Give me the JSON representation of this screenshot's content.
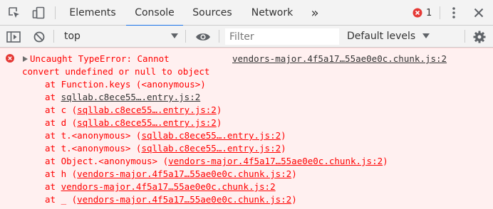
{
  "tabs": [
    {
      "label": "Elements",
      "active": false
    },
    {
      "label": "Console",
      "active": true
    },
    {
      "label": "Sources",
      "active": false
    },
    {
      "label": "Network",
      "active": false
    }
  ],
  "more_tabs_label": "»",
  "error_count": "1",
  "colors": {
    "accent": "#1a73e8",
    "error_text": "#ff0000",
    "error_bg": "#fff0f0",
    "error_badge": "#e53935"
  },
  "toolbar": {
    "context": "top",
    "filter_placeholder": "Filter",
    "filter_value": "",
    "levels_label": "Default levels"
  },
  "error": {
    "message_line1": "Uncaught TypeError: Cannot",
    "message_line2": "convert undefined or null to object",
    "source_link": "vendors-major.4f5a17…55ae0e0c.chunk.js:2",
    "stack": [
      {
        "prefix": "at Function.keys (<anonymous>)",
        "link": "",
        "suffix": ""
      },
      {
        "prefix": "at ",
        "link": "sqllab.c8ece55….entry.js:2",
        "suffix": ""
      },
      {
        "prefix": "at c (",
        "link": "sqllab.c8ece55….entry.js:2",
        "suffix": ")"
      },
      {
        "prefix": "at d (",
        "link": "sqllab.c8ece55….entry.js:2",
        "suffix": ")"
      },
      {
        "prefix": "at t.<anonymous> (",
        "link": "sqllab.c8ece55….entry.js:2",
        "suffix": ")"
      },
      {
        "prefix": "at t.<anonymous> (",
        "link": "sqllab.c8ece55….entry.js:2",
        "suffix": ")"
      },
      {
        "prefix": "at Object.<anonymous> (",
        "link": "vendors-major.4f5a17…55ae0e0c.chunk.js:2",
        "suffix": ")"
      },
      {
        "prefix": "at h (",
        "link": "vendors-major.4f5a17…55ae0e0c.chunk.js:2",
        "suffix": ")"
      },
      {
        "prefix": "at ",
        "link": "vendors-major.4f5a17…55ae0e0c.chunk.js:2",
        "suffix": ""
      },
      {
        "prefix": "at _ (",
        "link": "vendors-major.4f5a17…55ae0e0c.chunk.js:2",
        "suffix": ")"
      }
    ]
  }
}
